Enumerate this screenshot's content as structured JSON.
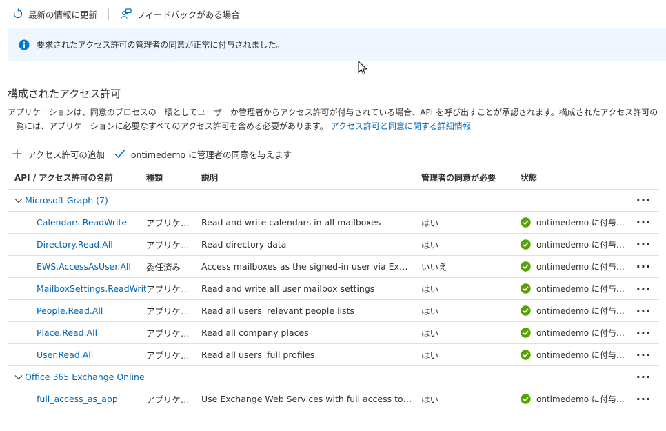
{
  "toolbar": {
    "refresh_label": "最新の情報に更新",
    "feedback_label": "フィードバックがある場合"
  },
  "info": {
    "message": "要求されたアクセス許可の管理者の同意が正常に付与されました。"
  },
  "section": {
    "title": "構成されたアクセス許可",
    "description": "アプリケーションは、同意のプロセスの一環としてユーザーか管理者からアクセス許可が付与されている場合、API を呼び出すことが承認されます。構成されたアクセス許可の一覧には、アプリケーションに必要なすべてのアクセス許可を含める必要があります。",
    "learn_more": "アクセス許可と同意に関する詳細情報"
  },
  "commands": {
    "add_permission": "アクセス許可の追加",
    "grant_consent": "ontimedemo に管理者の同意を与えます"
  },
  "table": {
    "headers": {
      "name": "API / アクセス許可の名前",
      "type": "種類",
      "description": "説明",
      "admin_consent": "管理者の同意が必要",
      "status": "状態"
    },
    "groups": [
      {
        "title": "Microsoft Graph (7)",
        "rows": [
          {
            "name": "Calendars.ReadWrite",
            "type": "アプリケー…",
            "description": "Read and write calendars in all mailboxes",
            "admin": "はい",
            "status": "ontimedemo に付与さ…"
          },
          {
            "name": "Directory.Read.All",
            "type": "アプリケー…",
            "description": "Read directory data",
            "admin": "はい",
            "status": "ontimedemo に付与さ…"
          },
          {
            "name": "EWS.AccessAsUser.All",
            "type": "委任済み",
            "description": "Access mailboxes as the signed-in user via Ex…",
            "admin": "いいえ",
            "status": "ontimedemo に付与さ…"
          },
          {
            "name": "MailboxSettings.ReadWrit",
            "type": "アプリケー…",
            "description": "Read and write all user mailbox settings",
            "admin": "はい",
            "status": "ontimedemo に付与さ…"
          },
          {
            "name": "People.Read.All",
            "type": "アプリケー…",
            "description": "Read all users' relevant people lists",
            "admin": "はい",
            "status": "ontimedemo に付与さ…"
          },
          {
            "name": "Place.Read.All",
            "type": "アプリケー…",
            "description": "Read all company places",
            "admin": "はい",
            "status": "ontimedemo に付与さ…"
          },
          {
            "name": "User.Read.All",
            "type": "アプリケー…",
            "description": "Read all users' full profiles",
            "admin": "はい",
            "status": "ontimedemo に付与さ…"
          }
        ]
      },
      {
        "title": "Office 365 Exchange Online",
        "rows": [
          {
            "name": "full_access_as_app",
            "type": "アプリケー…",
            "description": "Use Exchange Web Services with full access to…",
            "admin": "はい",
            "status": "ontimedemo に付与さ…"
          }
        ]
      }
    ]
  },
  "colors": {
    "link": "#0067b8",
    "info_bg": "#f0f6ff",
    "success": "#57a300"
  }
}
